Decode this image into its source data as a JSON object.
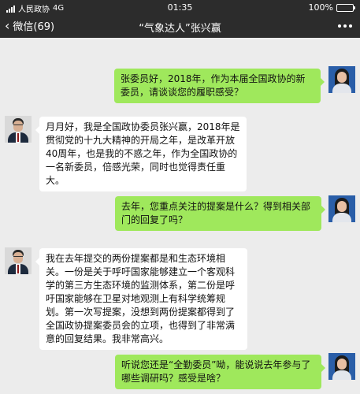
{
  "status_bar": {
    "carrier": "人民政协",
    "network": "4G",
    "time": "01:35",
    "battery": "100%",
    "battery_level": 1.0
  },
  "nav": {
    "back_label": "微信(69)",
    "title": "“气象达人”张兴赢"
  },
  "messages": [
    {
      "side": "right",
      "sender": "interviewer",
      "text": "张委员好，2018年，作为本届全国政协的新委员，请谈谈您的履职感受？"
    },
    {
      "side": "left",
      "sender": "张兴赢",
      "text": "月月好，我是全国政协委员张兴赢，2018年是贯彻党的十九大精神的开局之年，是改革开放40周年，也是我的不惑之年，作为全国政协的一名新委员，倍感光荣，同时也觉得责任重大。"
    },
    {
      "side": "right",
      "sender": "interviewer",
      "text": "去年，您重点关注的提案是什么？得到相关部门的回复了吗？"
    },
    {
      "side": "left",
      "sender": "张兴赢",
      "text": "我在去年提交的两份提案都是和生态环境相关。一份是关于呼吁国家能够建立一个客观科学的第三方生态环境的监测体系，第二份是呼吁国家能够在卫星对地观测上有科学统筹规划。第一次写提案，没想到两份提案都得到了全国政协提案委员会的立项，也得到了非常满意的回复结果。我非常高兴。"
    },
    {
      "side": "right",
      "sender": "interviewer",
      "text": "听说您还是“全勤委员”呦，能说说去年参与了哪些调研吗？感受是啥？"
    }
  ]
}
